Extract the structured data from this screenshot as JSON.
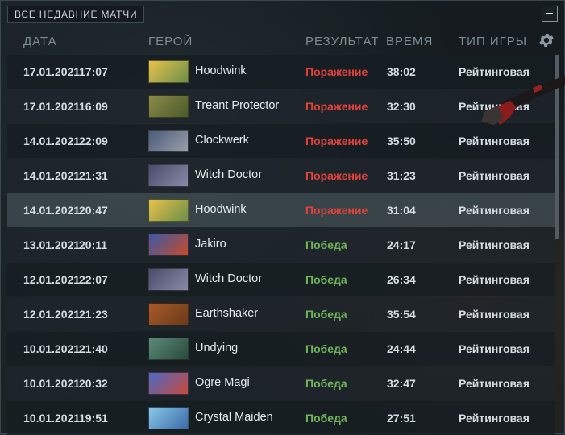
{
  "panel": {
    "title": "ВСЕ НЕДАВНИЕ МАТЧИ",
    "collapse_icon": "minus-icon",
    "settings_icon": "gear-icon"
  },
  "columns": {
    "date": "ДАТА",
    "hero": "ГЕРОЙ",
    "result": "РЕЗУЛЬТАТ",
    "duration": "ВРЕМЯ",
    "game_type": "ТИП ИГРЫ"
  },
  "colors": {
    "loss": "#e2423b",
    "win": "#6fb45a"
  },
  "matches": [
    {
      "date": "17.01.2021",
      "time": "17:07",
      "hero": "Hoodwink",
      "result": "Поражение",
      "outcome": "loss",
      "duration": "38:02",
      "game_type": "Рейтинговая",
      "portrait": [
        "#e8c14a",
        "#6b8f4a"
      ]
    },
    {
      "date": "17.01.2021",
      "time": "16:09",
      "hero": "Treant Protector",
      "result": "Поражение",
      "outcome": "loss",
      "duration": "32:30",
      "game_type": "Рейтинговая",
      "portrait": [
        "#8a8a4a",
        "#4b5a2a"
      ]
    },
    {
      "date": "14.01.2021",
      "time": "22:09",
      "hero": "Clockwerk",
      "result": "Поражение",
      "outcome": "loss",
      "duration": "35:50",
      "game_type": "Рейтинговая",
      "portrait": [
        "#4a5a7a",
        "#9aa0a8"
      ]
    },
    {
      "date": "14.01.2021",
      "time": "21:31",
      "hero": "Witch Doctor",
      "result": "Поражение",
      "outcome": "loss",
      "duration": "31:23",
      "game_type": "Рейтинговая",
      "portrait": [
        "#4a4a6a",
        "#8a8aa8"
      ]
    },
    {
      "date": "14.01.2021",
      "time": "20:47",
      "hero": "Hoodwink",
      "result": "Поражение",
      "outcome": "loss",
      "duration": "31:04",
      "game_type": "Рейтинговая",
      "portrait": [
        "#e8c14a",
        "#6b8f4a"
      ]
    },
    {
      "date": "13.01.2021",
      "time": "20:11",
      "hero": "Jakiro",
      "result": "Победа",
      "outcome": "win",
      "duration": "24:17",
      "game_type": "Рейтинговая",
      "portrait": [
        "#3a5aa8",
        "#c84a2a"
      ]
    },
    {
      "date": "12.01.2021",
      "time": "22:07",
      "hero": "Witch Doctor",
      "result": "Победа",
      "outcome": "win",
      "duration": "26:34",
      "game_type": "Рейтинговая",
      "portrait": [
        "#4a4a6a",
        "#8a8aa8"
      ]
    },
    {
      "date": "12.01.2021",
      "time": "21:23",
      "hero": "Earthshaker",
      "result": "Победа",
      "outcome": "win",
      "duration": "35:54",
      "game_type": "Рейтинговая",
      "portrait": [
        "#a85a2a",
        "#6a3a1a"
      ]
    },
    {
      "date": "10.01.2021",
      "time": "21:40",
      "hero": "Undying",
      "result": "Победа",
      "outcome": "win",
      "duration": "24:44",
      "game_type": "Рейтинговая",
      "portrait": [
        "#5a8a7a",
        "#2a4a3a"
      ]
    },
    {
      "date": "10.01.2021",
      "time": "20:32",
      "hero": "Ogre Magi",
      "result": "Победа",
      "outcome": "win",
      "duration": "32:47",
      "game_type": "Рейтинговая",
      "portrait": [
        "#4a6ac8",
        "#c84a3a"
      ]
    },
    {
      "date": "10.01.2021",
      "time": "19:51",
      "hero": "Crystal Maiden",
      "result": "Победа",
      "outcome": "win",
      "duration": "27:51",
      "game_type": "Рейтинговая",
      "portrait": [
        "#8ac8e8",
        "#3a6aa8"
      ]
    }
  ]
}
